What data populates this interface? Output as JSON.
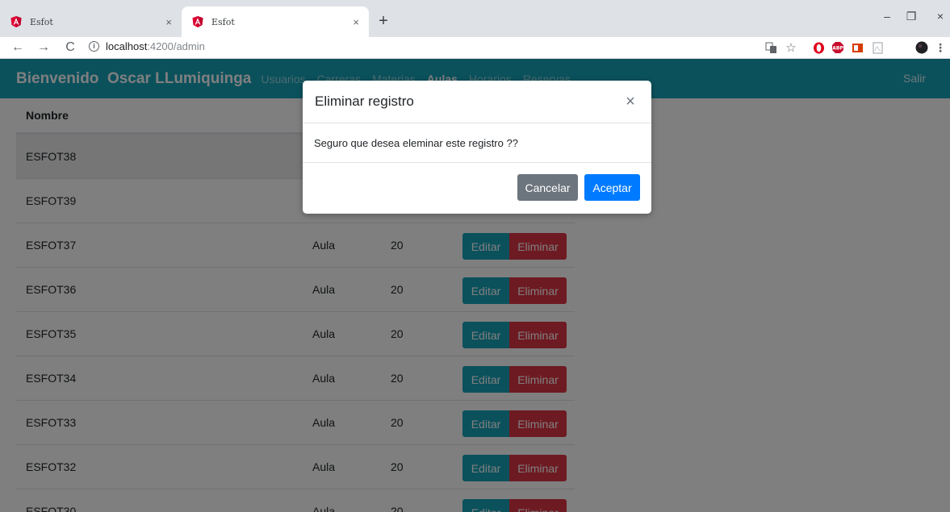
{
  "browser": {
    "tabs": [
      {
        "title": "Esfot",
        "close": "×"
      },
      {
        "title": "Esfot",
        "close": "×"
      }
    ],
    "new_tab": "+",
    "window_controls": {
      "minimize": "–",
      "maximize": "❐",
      "close": "×"
    },
    "nav": {
      "back": "←",
      "forward": "→",
      "reload": "C"
    },
    "address": {
      "info": "i",
      "host": "localhost",
      "path": ":4200/admin"
    },
    "menu": "⋮",
    "accent_color": "#dd0031"
  },
  "navbar": {
    "brand": "Bienvenido  Oscar LLumiquinga",
    "links": [
      "Usuarios",
      "Carreras",
      "Materias",
      "Aulas",
      "Horarios",
      "Reservas"
    ],
    "active_link": "Aulas",
    "logout": "Salir",
    "color": "#17a2b8"
  },
  "table": {
    "header": {
      "name": "Nombre"
    },
    "rows": [
      {
        "name": "ESFOT38",
        "type": "",
        "capacity": ""
      },
      {
        "name": "ESFOT39",
        "type": "",
        "capacity": ""
      },
      {
        "name": "ESFOT37",
        "type": "Aula",
        "capacity": "20"
      },
      {
        "name": "ESFOT36",
        "type": "Aula",
        "capacity": "20"
      },
      {
        "name": "ESFOT35",
        "type": "Aula",
        "capacity": "20"
      },
      {
        "name": "ESFOT34",
        "type": "Aula",
        "capacity": "20"
      },
      {
        "name": "ESFOT33",
        "type": "Aula",
        "capacity": "20"
      },
      {
        "name": "ESFOT32",
        "type": "Aula",
        "capacity": "20"
      },
      {
        "name": "ESFOT30",
        "type": "Aula",
        "capacity": "20"
      }
    ],
    "edit_label": "Editar",
    "delete_label": "Eliminar"
  },
  "modal": {
    "title": "Eliminar registro",
    "close": "×",
    "body": "Seguro que desea eleminar este registro ??",
    "cancel_label": "Cancelar",
    "accept_label": "Aceptar"
  }
}
